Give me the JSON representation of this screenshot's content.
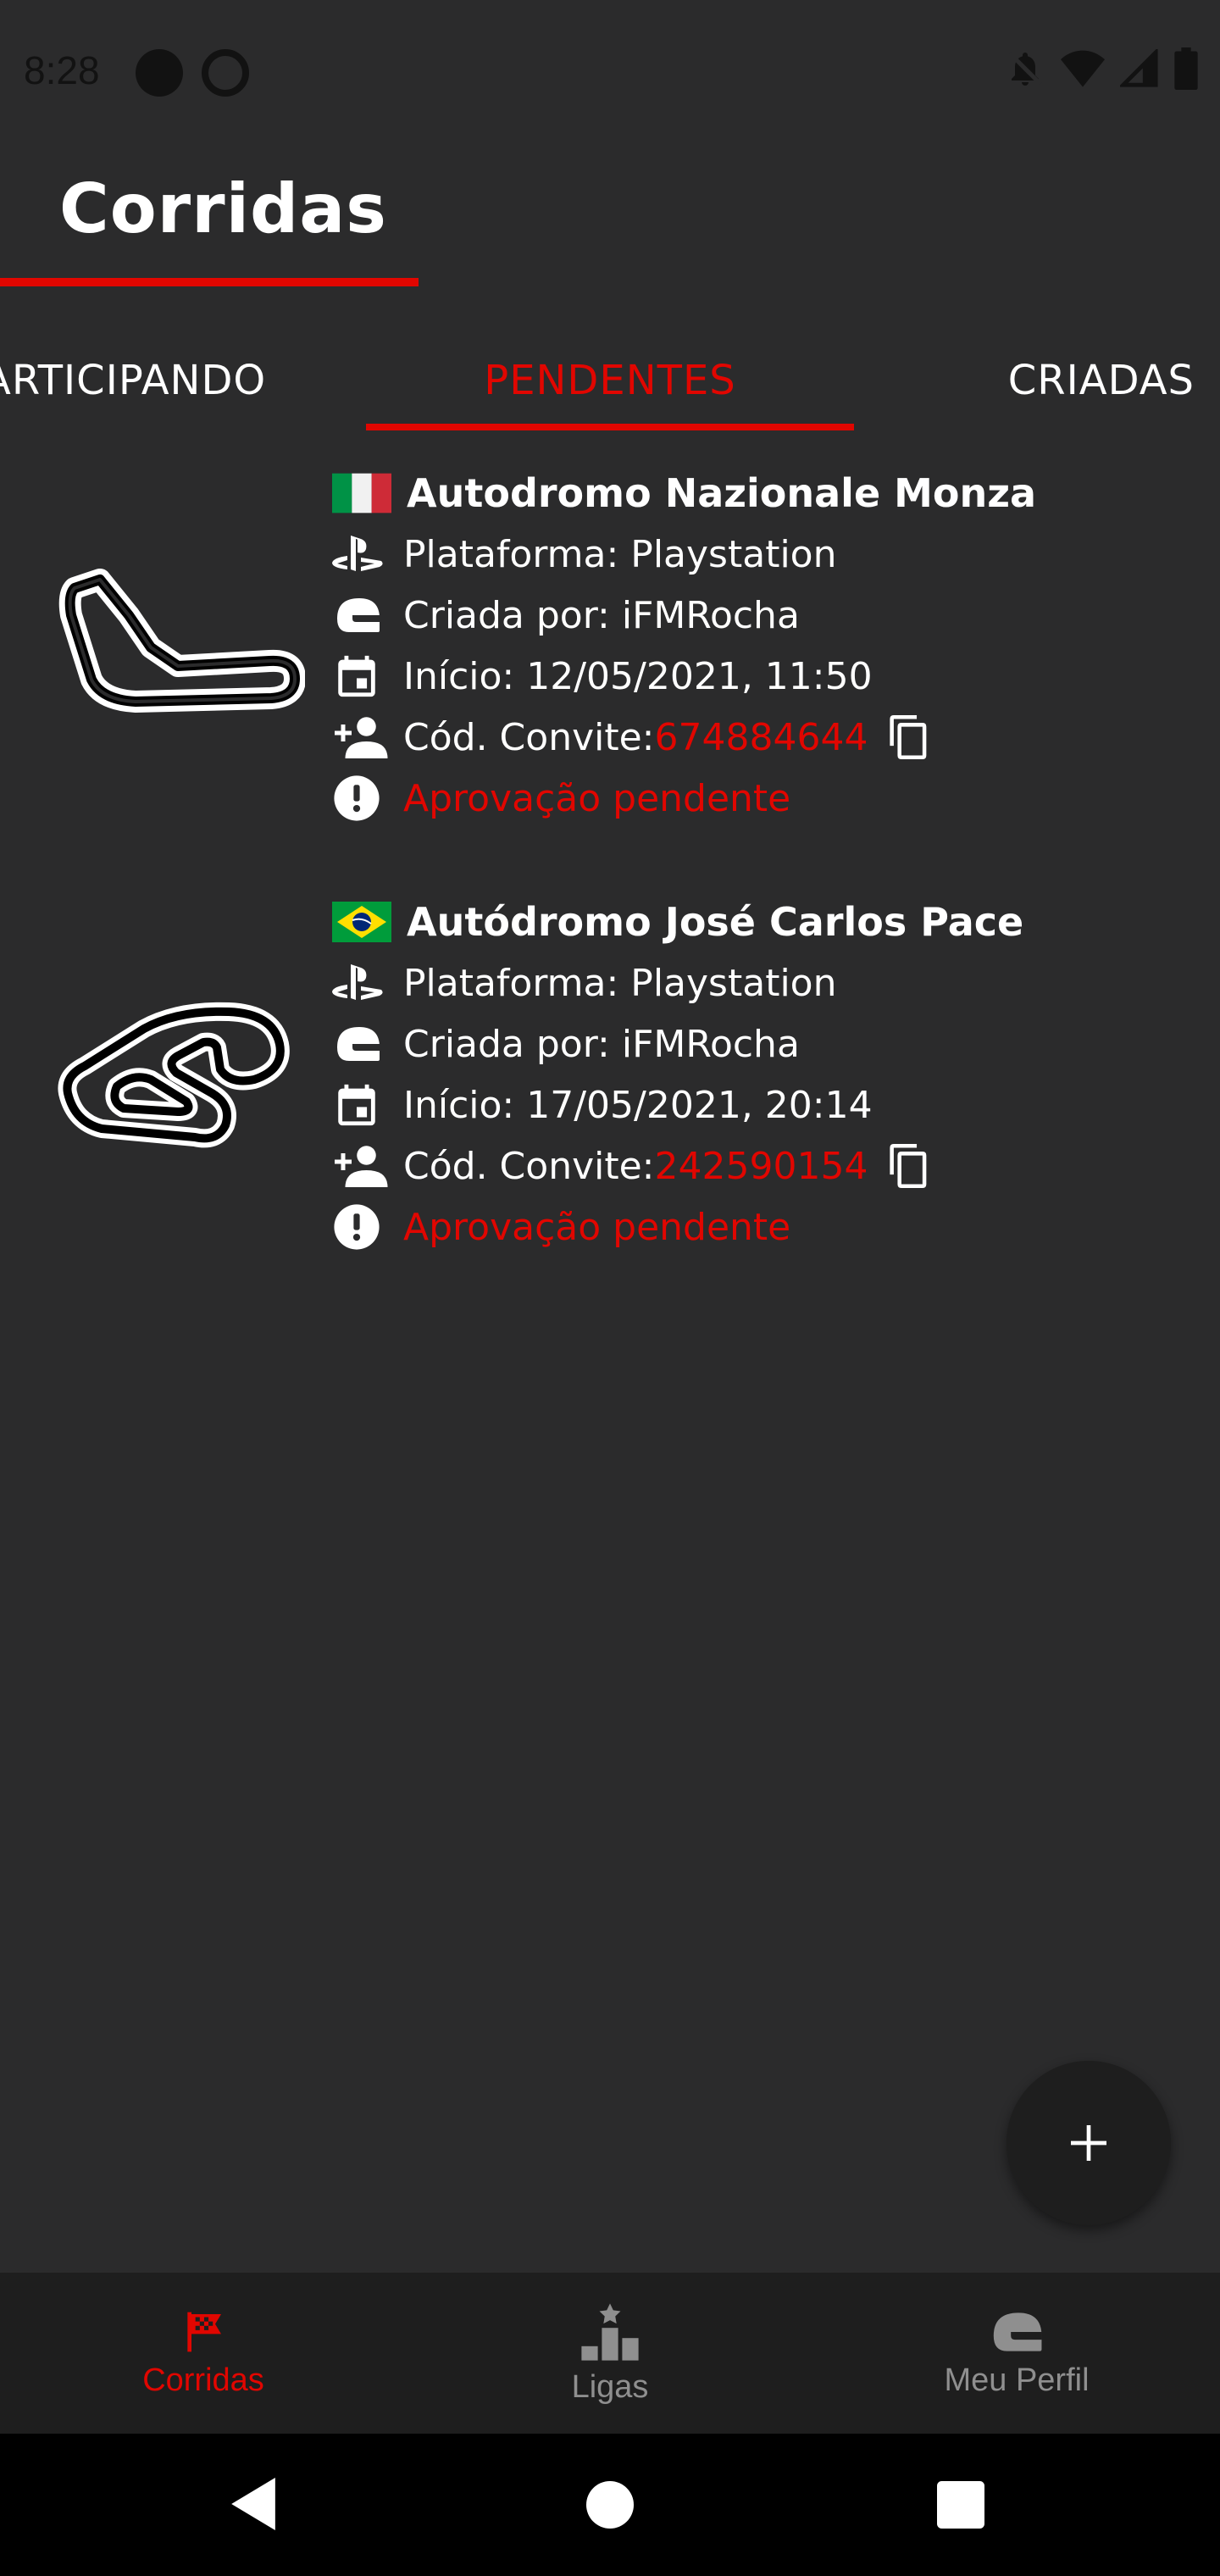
{
  "status_bar": {
    "time": "8:28"
  },
  "header": {
    "title": "Corridas"
  },
  "tabs": [
    {
      "label": "ARTICIPANDO"
    },
    {
      "label": "PENDENTES",
      "active": true
    },
    {
      "label": "CRIADAS"
    }
  ],
  "races": [
    {
      "name": "Autodromo Nazionale Monza",
      "flag": "italy-flag",
      "platform": "Plataforma: Playstation",
      "created_by": "Criada por: iFMRocha",
      "start": "Início: 12/05/2021, 11:50",
      "invite_label": "Cód. Convite: ",
      "invite_code": "674884644",
      "status": "Aprovação pendente"
    },
    {
      "name": "Autódromo José Carlos Pace",
      "flag": "brazil-flag",
      "platform": "Plataforma: Playstation",
      "created_by": "Criada por: iFMRocha",
      "start": "Início: 17/05/2021, 20:14",
      "invite_label": "Cód. Convite: ",
      "invite_code": "242590154",
      "status": "Aprovação pendente"
    }
  ],
  "bottom_nav": [
    {
      "label": "Corridas",
      "icon": "checkered-flag-icon",
      "active": true
    },
    {
      "label": "Ligas",
      "icon": "podium-icon"
    },
    {
      "label": "Meu Perfil",
      "icon": "helmet-icon"
    }
  ],
  "colors": {
    "accent": "#e10600",
    "background": "#2b2b2c",
    "nav_bg": "#1e1e1e"
  }
}
